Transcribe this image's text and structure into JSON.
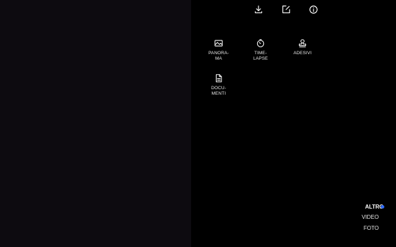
{
  "toolbar": {
    "icons": [
      "download-icon",
      "edit-icon",
      "info-icon"
    ]
  },
  "modes": {
    "panorama": {
      "label": "PANORA-\nMA",
      "icon": "panorama-icon"
    },
    "timelapse": {
      "label": "TIME-\nLAPSE",
      "icon": "timer-icon"
    },
    "stickers": {
      "label": "ADESIVI",
      "icon": "stamp-icon"
    },
    "documents": {
      "label": "DOCU-\nMENTI",
      "icon": "document-icon"
    }
  },
  "mode_switcher": {
    "items": [
      {
        "label": "ALTRO",
        "active": true
      },
      {
        "label": "VIDEO",
        "active": false
      },
      {
        "label": "FOTO",
        "active": false
      }
    ],
    "active_color": "#2f6bff"
  }
}
